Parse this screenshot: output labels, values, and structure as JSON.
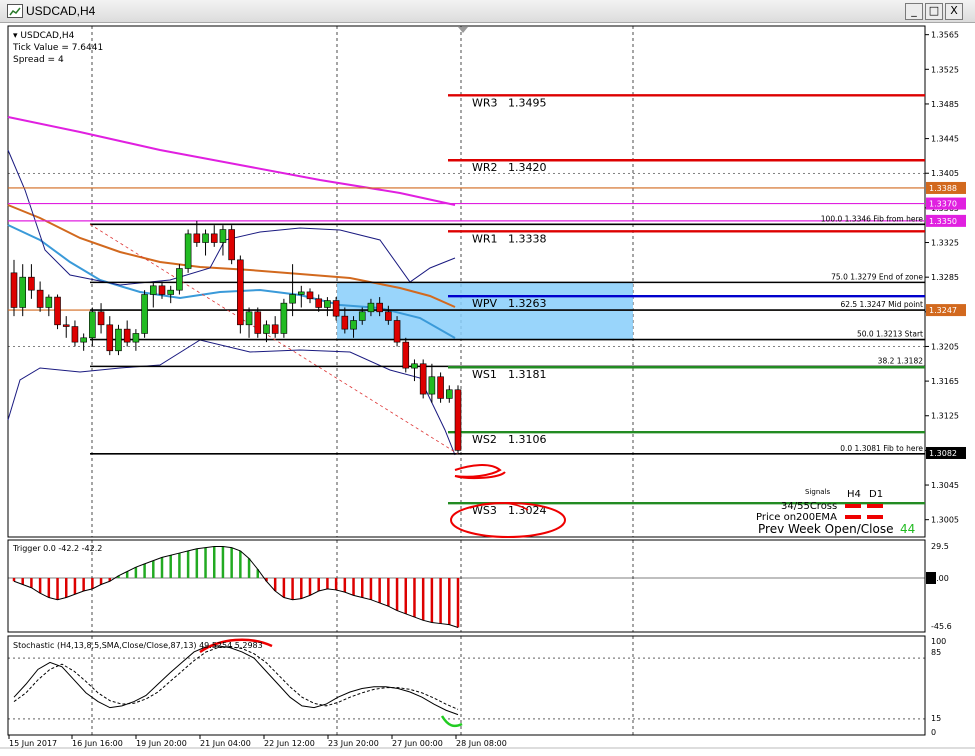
{
  "window": {
    "title": "USDCAD,H4",
    "minimize": "_",
    "maximize": "□",
    "close": "X"
  },
  "info": {
    "symbol": "USDCAD,H4",
    "tick_value": "Tick Value = 7.6441",
    "spread": "Spread = 4"
  },
  "price_axis": {
    "ticks": [
      "1.3565",
      "1.3525",
      "1.3485",
      "1.3445",
      "1.3405",
      "1.3365",
      "1.3325",
      "1.3285",
      "1.3245",
      "1.3205",
      "1.3165",
      "1.3125",
      "1.3085",
      "1.3045",
      "1.3005"
    ],
    "highlights": [
      {
        "text": "1.3388",
        "color": "#d2691e"
      },
      {
        "text": "1.3370",
        "color": "#e020e0"
      },
      {
        "text": "1.3350",
        "color": "#e020e0"
      },
      {
        "text": "1.3247",
        "color": "#d2691e"
      },
      {
        "text": "1.3082",
        "color": "#000000"
      }
    ]
  },
  "pivots": [
    {
      "name": "WR3",
      "value": "1.3495",
      "color": "#dd0000"
    },
    {
      "name": "WR2",
      "value": "1.3420",
      "color": "#dd0000"
    },
    {
      "name": "WR1",
      "value": "1.3338",
      "color": "#dd0000"
    },
    {
      "name": "WPV",
      "value": "1.3263",
      "color": "#0000cc"
    },
    {
      "name": "WS1",
      "value": "1.3181",
      "color": "#228b22"
    },
    {
      "name": "WS2",
      "value": "1.3106",
      "color": "#228b22"
    },
    {
      "name": "WS3",
      "value": "1.3024",
      "color": "#228b22"
    }
  ],
  "fib": [
    {
      "level": "100.0",
      "price": "1.3346",
      "note": "Fib from here"
    },
    {
      "level": "75.0",
      "price": "1.3279",
      "note": "End of zone"
    },
    {
      "level": "62.5",
      "price": "1.3247",
      "note": "Mid point"
    },
    {
      "level": "50.0",
      "price": "1.3213",
      "note": "Start"
    },
    {
      "level": "38.2",
      "price": "1.3182",
      "note": ""
    },
    {
      "level": "0.0",
      "price": "1.3081",
      "note": "Fib to here"
    }
  ],
  "signals": {
    "title": "Signals",
    "h4": "H4",
    "d1": "D1",
    "cross": "34/55Cross",
    "ema": "Price on200EMA",
    "prev": "Prev Week Open/Close",
    "prev_value": "44"
  },
  "trigger": {
    "label": "Trigger 0.0 -42.2 -42.2",
    "top": "29.5",
    "zero": "0.00",
    "bottom": "-45.6"
  },
  "stochastic": {
    "label": "Stochastic (H4,13,8,5,SMA,Close/Close,87,13) 49.5254 5.2983",
    "top": "100",
    "upper": "85",
    "lower": "15",
    "bottom": "0"
  },
  "time_axis": [
    "15 Jun 2017",
    "16 Jun 16:00",
    "19 Jun 20:00",
    "21 Jun 04:00",
    "22 Jun 12:00",
    "23 Jun 20:00",
    "27 Jun 00:00",
    "28 Jun 08:00"
  ],
  "chart_data": {
    "type": "candlestick",
    "symbol": "USDCAD",
    "timeframe": "H4",
    "ylim": [
      1.2985,
      1.3575
    ],
    "candles": [
      [
        1.329,
        1.3305,
        1.324,
        1.325
      ],
      [
        1.325,
        1.33,
        1.324,
        1.3285
      ],
      [
        1.3285,
        1.33,
        1.326,
        1.327
      ],
      [
        1.327,
        1.328,
        1.3245,
        1.325
      ],
      [
        1.325,
        1.3265,
        1.324,
        1.3262
      ],
      [
        1.3262,
        1.3265,
        1.3225,
        1.323
      ],
      [
        1.323,
        1.324,
        1.3215,
        1.3228
      ],
      [
        1.3228,
        1.3235,
        1.3205,
        1.321
      ],
      [
        1.321,
        1.322,
        1.32,
        1.3215
      ],
      [
        1.3215,
        1.325,
        1.3205,
        1.3245
      ],
      [
        1.3245,
        1.3255,
        1.322,
        1.323
      ],
      [
        1.323,
        1.324,
        1.3195,
        1.32
      ],
      [
        1.32,
        1.323,
        1.3195,
        1.3225
      ],
      [
        1.3225,
        1.3235,
        1.3205,
        1.321
      ],
      [
        1.321,
        1.3225,
        1.32,
        1.322
      ],
      [
        1.322,
        1.327,
        1.3215,
        1.3265
      ],
      [
        1.3265,
        1.328,
        1.325,
        1.3275
      ],
      [
        1.3275,
        1.328,
        1.326,
        1.3265
      ],
      [
        1.3265,
        1.3275,
        1.3255,
        1.327
      ],
      [
        1.327,
        1.33,
        1.3265,
        1.3295
      ],
      [
        1.3295,
        1.334,
        1.329,
        1.3335
      ],
      [
        1.3335,
        1.335,
        1.332,
        1.3325
      ],
      [
        1.3325,
        1.334,
        1.331,
        1.3335
      ],
      [
        1.3335,
        1.3345,
        1.332,
        1.3325
      ],
      [
        1.3325,
        1.3345,
        1.331,
        1.334
      ],
      [
        1.334,
        1.3345,
        1.33,
        1.3305
      ],
      [
        1.3305,
        1.331,
        1.322,
        1.323
      ],
      [
        1.323,
        1.325,
        1.3215,
        1.3245
      ],
      [
        1.3245,
        1.325,
        1.3215,
        1.322
      ],
      [
        1.322,
        1.3235,
        1.321,
        1.323
      ],
      [
        1.323,
        1.324,
        1.3215,
        1.322
      ],
      [
        1.322,
        1.326,
        1.3215,
        1.3255
      ],
      [
        1.3255,
        1.33,
        1.324,
        1.3265
      ],
      [
        1.3265,
        1.3275,
        1.325,
        1.3268
      ],
      [
        1.3268,
        1.3272,
        1.3255,
        1.326
      ],
      [
        1.326,
        1.3265,
        1.3245,
        1.325
      ],
      [
        1.325,
        1.3262,
        1.324,
        1.3258
      ],
      [
        1.3258,
        1.3262,
        1.3235,
        1.324
      ],
      [
        1.324,
        1.325,
        1.322,
        1.3225
      ],
      [
        1.3225,
        1.324,
        1.3215,
        1.3235
      ],
      [
        1.3235,
        1.325,
        1.323,
        1.3245
      ],
      [
        1.3245,
        1.326,
        1.324,
        1.3255
      ],
      [
        1.3255,
        1.3262,
        1.324,
        1.3245
      ],
      [
        1.3245,
        1.3252,
        1.323,
        1.3235
      ],
      [
        1.3235,
        1.324,
        1.3205,
        1.321
      ],
      [
        1.321,
        1.3215,
        1.3175,
        1.318
      ],
      [
        1.318,
        1.319,
        1.3165,
        1.3185
      ],
      [
        1.3185,
        1.319,
        1.3145,
        1.315
      ],
      [
        1.315,
        1.3185,
        1.314,
        1.317
      ],
      [
        1.317,
        1.3175,
        1.314,
        1.3145
      ],
      [
        1.3145,
        1.316,
        1.314,
        1.3155
      ],
      [
        1.3155,
        1.316,
        1.3081,
        1.3085
      ]
    ],
    "time_labels": [
      "15 Jun 2017",
      "16 Jun 16:00",
      "19 Jun 20:00",
      "21 Jun 04:00",
      "22 Jun 12:00",
      "23 Jun 20:00",
      "27 Jun 00:00",
      "28 Jun 08:00"
    ],
    "zone": {
      "top": 1.3279,
      "bottom": 1.3213
    },
    "trigger_histogram": [
      -3,
      -6,
      -9,
      -14,
      -18,
      -20,
      -18,
      -15,
      -12,
      -10,
      -6,
      -3,
      2,
      6,
      10,
      13,
      16,
      19,
      21,
      23,
      25,
      27,
      28,
      29,
      29,
      28,
      25,
      18,
      8,
      -3,
      -12,
      -18,
      -20,
      -19,
      -16,
      -12,
      -10,
      -11,
      -13,
      -16,
      -18,
      -20,
      -23,
      -26,
      -30,
      -33,
      -36,
      -39,
      -41,
      -42,
      -43,
      -45.6
    ],
    "stochastic_main": [
      40,
      55,
      72,
      80,
      75,
      60,
      45,
      35,
      28,
      30,
      35,
      42,
      55,
      68,
      80,
      92,
      98,
      99,
      97,
      92,
      85,
      70,
      55,
      40,
      30,
      28,
      32,
      40,
      46,
      50,
      52,
      52,
      50,
      46,
      40,
      32,
      25,
      20
    ],
    "stochastic_signal": [
      35,
      45,
      60,
      72,
      78,
      70,
      58,
      45,
      36,
      32,
      33,
      38,
      46,
      58,
      70,
      82,
      92,
      97,
      98,
      96,
      90,
      80,
      66,
      52,
      40,
      33,
      30,
      34,
      40,
      45,
      49,
      51,
      51,
      49,
      45,
      39,
      32,
      26
    ]
  }
}
